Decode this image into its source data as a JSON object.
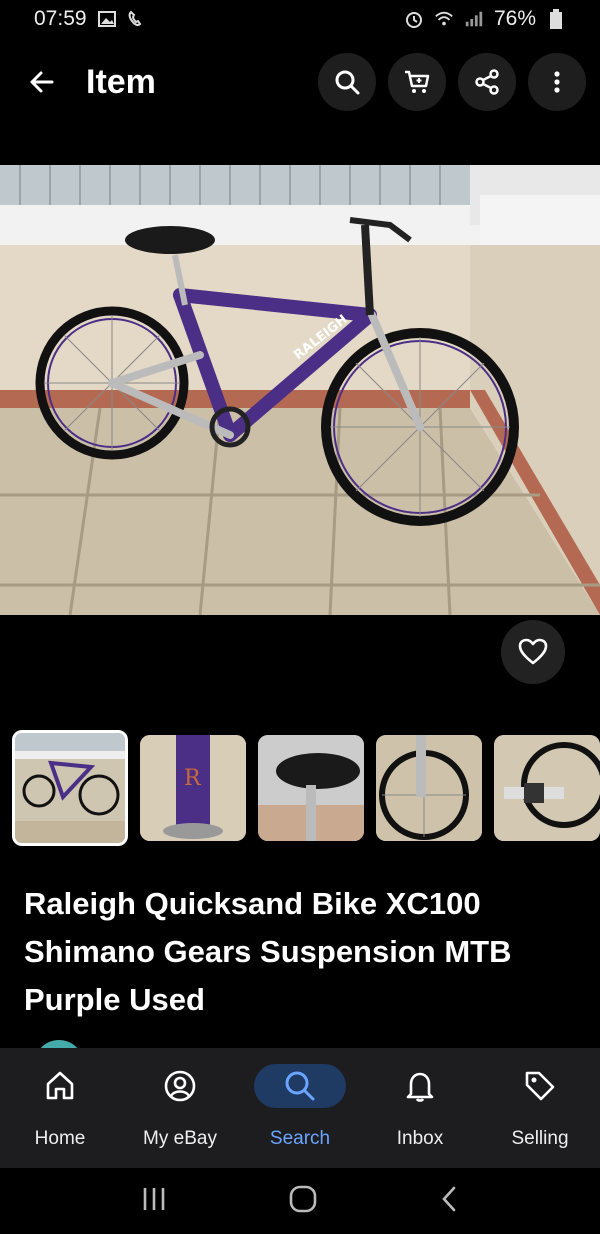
{
  "status": {
    "time": "07:59",
    "battery": "76%"
  },
  "appbar": {
    "title": "Item"
  },
  "item": {
    "title": "Raleigh Quicksand Bike XC100 Shimano Gears Suspension MTB Purple Used"
  },
  "nav": [
    {
      "label": "Home",
      "icon": "home-icon"
    },
    {
      "label": "My eBay",
      "icon": "user-icon"
    },
    {
      "label": "Search",
      "icon": "search-icon"
    },
    {
      "label": "Inbox",
      "icon": "bell-icon"
    },
    {
      "label": "Selling",
      "icon": "tag-icon"
    }
  ],
  "colors": {
    "accent": "#6aa5ff",
    "bike": "#4b2e86",
    "background": "#000000"
  }
}
